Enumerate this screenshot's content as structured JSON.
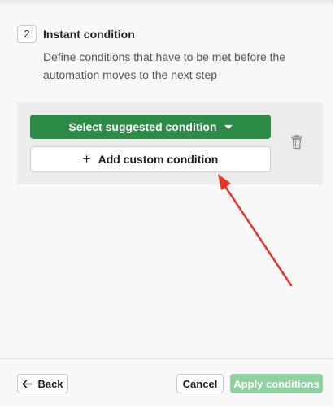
{
  "step": {
    "number": "2",
    "title": "Instant condition",
    "description": "Define conditions that have to be met before the automation moves to the next step"
  },
  "conditions": {
    "suggested_label": "Select suggested condition",
    "custom_label": "Add custom condition",
    "suggested_icon": "caret-down-icon",
    "custom_icon": "plus-icon",
    "delete_icon": "trash-icon"
  },
  "footer": {
    "back_label": "Back",
    "back_icon": "arrow-left-icon",
    "cancel_label": "Cancel",
    "apply_label": "Apply conditions"
  },
  "colors": {
    "primary_green": "#2e8b47",
    "apply_disabled": "#8fd1a1",
    "annotation_arrow": "#e8372a"
  }
}
